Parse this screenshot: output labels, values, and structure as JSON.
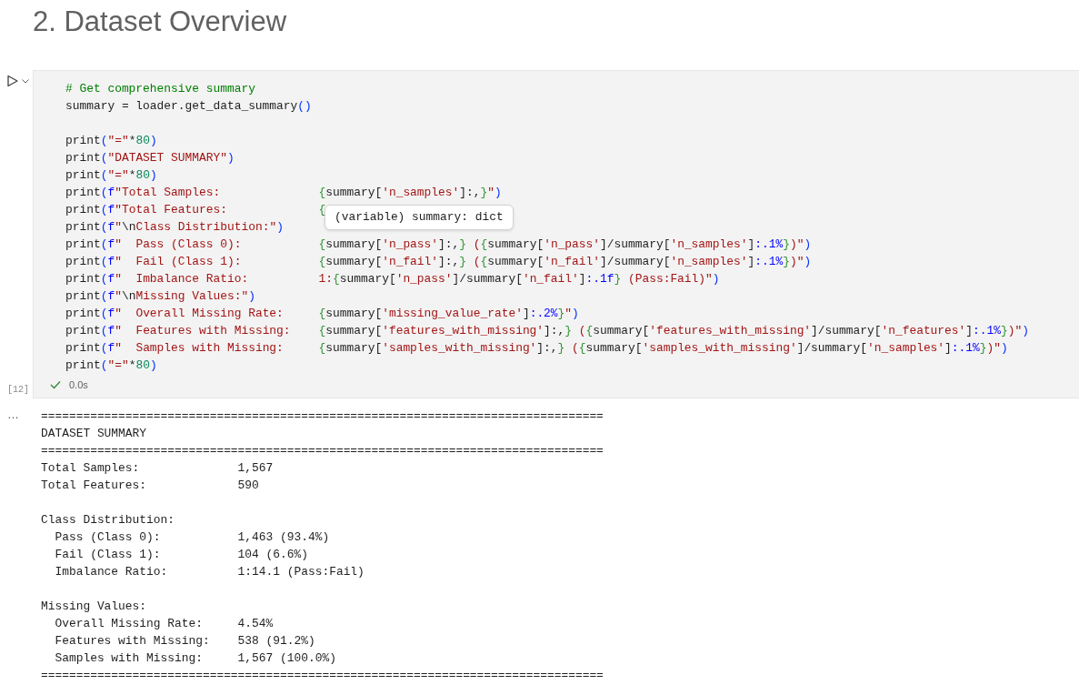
{
  "heading": "2. Dataset Overview",
  "cell": {
    "execution_count": "[12]",
    "succeeded": true,
    "duration": "0.0s",
    "tooltip": "(variable) summary: dict",
    "code_blocks": [
      [
        [
          {
            "kind": "comment",
            "text": "# Get comprehensive summary"
          }
        ],
        [
          {
            "kind": "plain",
            "text": "summary = loader.get_data_summary"
          },
          {
            "kind": "paren",
            "text": "()"
          }
        ]
      ],
      [
        [
          {
            "kind": "plain",
            "text": "print"
          },
          {
            "kind": "paren",
            "text": "("
          },
          {
            "kind": "string",
            "text": "\"=\""
          },
          {
            "kind": "plain",
            "text": "*"
          },
          {
            "kind": "number",
            "text": "80"
          },
          {
            "kind": "paren",
            "text": ")"
          }
        ],
        [
          {
            "kind": "plain",
            "text": "print"
          },
          {
            "kind": "paren",
            "text": "("
          },
          {
            "kind": "string",
            "text": "\"DATASET SUMMARY\""
          },
          {
            "kind": "paren",
            "text": ")"
          }
        ],
        [
          {
            "kind": "plain",
            "text": "print"
          },
          {
            "kind": "paren",
            "text": "("
          },
          {
            "kind": "string",
            "text": "\"=\""
          },
          {
            "kind": "plain",
            "text": "*"
          },
          {
            "kind": "number",
            "text": "80"
          },
          {
            "kind": "paren",
            "text": ")"
          }
        ],
        [
          {
            "kind": "plain",
            "text": "print"
          },
          {
            "kind": "paren",
            "text": "("
          },
          {
            "kind": "prefix",
            "text": "f"
          },
          {
            "kind": "string",
            "text": "\"Total Samples:              "
          },
          {
            "kind": "brace",
            "text": "{"
          },
          {
            "kind": "plain",
            "text": "summary["
          },
          {
            "kind": "string",
            "text": "'n_samples'"
          },
          {
            "kind": "plain",
            "text": "]:,"
          },
          {
            "kind": "brace",
            "text": "}"
          },
          {
            "kind": "string",
            "text": "\""
          },
          {
            "kind": "paren",
            "text": ")"
          }
        ],
        [
          {
            "kind": "plain",
            "text": "print"
          },
          {
            "kind": "paren",
            "text": "("
          },
          {
            "kind": "prefix",
            "text": "f"
          },
          {
            "kind": "string",
            "text": "\"Total Features:             "
          },
          {
            "kind": "brace",
            "text": "{"
          }
        ],
        [
          {
            "kind": "plain",
            "text": "print"
          },
          {
            "kind": "paren",
            "text": "("
          },
          {
            "kind": "prefix",
            "text": "f"
          },
          {
            "kind": "string",
            "text": "\""
          },
          {
            "kind": "plain",
            "text": "\\n"
          },
          {
            "kind": "string",
            "text": "Class Distribution:\""
          },
          {
            "kind": "paren",
            "text": ")"
          }
        ],
        [
          {
            "kind": "plain",
            "text": "print"
          },
          {
            "kind": "paren",
            "text": "("
          },
          {
            "kind": "prefix",
            "text": "f"
          },
          {
            "kind": "string",
            "text": "\"  Pass (Class 0):           "
          },
          {
            "kind": "brace",
            "text": "{"
          },
          {
            "kind": "plain",
            "text": "summary["
          },
          {
            "kind": "string",
            "text": "'n_pass'"
          },
          {
            "kind": "plain",
            "text": "]:,"
          },
          {
            "kind": "brace",
            "text": "}"
          },
          {
            "kind": "string",
            "text": " ("
          },
          {
            "kind": "brace",
            "text": "{"
          },
          {
            "kind": "plain",
            "text": "summary["
          },
          {
            "kind": "string",
            "text": "'n_pass'"
          },
          {
            "kind": "plain",
            "text": "]/summary["
          },
          {
            "kind": "string",
            "text": "'n_samples'"
          },
          {
            "kind": "plain",
            "text": "]"
          },
          {
            "kind": "spec",
            "text": ":.1%"
          },
          {
            "kind": "brace",
            "text": "}"
          },
          {
            "kind": "string",
            "text": ")\""
          },
          {
            "kind": "paren",
            "text": ")"
          }
        ],
        [
          {
            "kind": "plain",
            "text": "print"
          },
          {
            "kind": "paren",
            "text": "("
          },
          {
            "kind": "prefix",
            "text": "f"
          },
          {
            "kind": "string",
            "text": "\"  Fail (Class 1):           "
          },
          {
            "kind": "brace",
            "text": "{"
          },
          {
            "kind": "plain",
            "text": "summary["
          },
          {
            "kind": "string",
            "text": "'n_fail'"
          },
          {
            "kind": "plain",
            "text": "]:,"
          },
          {
            "kind": "brace",
            "text": "}"
          },
          {
            "kind": "string",
            "text": " ("
          },
          {
            "kind": "brace",
            "text": "{"
          },
          {
            "kind": "plain",
            "text": "summary["
          },
          {
            "kind": "string",
            "text": "'n_fail'"
          },
          {
            "kind": "plain",
            "text": "]/summary["
          },
          {
            "kind": "string",
            "text": "'n_samples'"
          },
          {
            "kind": "plain",
            "text": "]"
          },
          {
            "kind": "spec",
            "text": ":.1%"
          },
          {
            "kind": "brace",
            "text": "}"
          },
          {
            "kind": "string",
            "text": ")\""
          },
          {
            "kind": "paren",
            "text": ")"
          }
        ],
        [
          {
            "kind": "plain",
            "text": "print"
          },
          {
            "kind": "paren",
            "text": "("
          },
          {
            "kind": "prefix",
            "text": "f"
          },
          {
            "kind": "string",
            "text": "\"  Imbalance Ratio:          1:"
          },
          {
            "kind": "brace",
            "text": "{"
          },
          {
            "kind": "plain",
            "text": "summary["
          },
          {
            "kind": "string",
            "text": "'n_pass'"
          },
          {
            "kind": "plain",
            "text": "]/summary["
          },
          {
            "kind": "string",
            "text": "'n_fail'"
          },
          {
            "kind": "plain",
            "text": "]"
          },
          {
            "kind": "spec",
            "text": ":.1f"
          },
          {
            "kind": "brace",
            "text": "}"
          },
          {
            "kind": "string",
            "text": " (Pass:Fail)\""
          },
          {
            "kind": "paren",
            "text": ")"
          }
        ],
        [
          {
            "kind": "plain",
            "text": "print"
          },
          {
            "kind": "paren",
            "text": "("
          },
          {
            "kind": "prefix",
            "text": "f"
          },
          {
            "kind": "string",
            "text": "\""
          },
          {
            "kind": "plain",
            "text": "\\n"
          },
          {
            "kind": "string",
            "text": "Missing Values:\""
          },
          {
            "kind": "paren",
            "text": ")"
          }
        ],
        [
          {
            "kind": "plain",
            "text": "print"
          },
          {
            "kind": "paren",
            "text": "("
          },
          {
            "kind": "prefix",
            "text": "f"
          },
          {
            "kind": "string",
            "text": "\"  Overall Missing Rate:     "
          },
          {
            "kind": "brace",
            "text": "{"
          },
          {
            "kind": "plain",
            "text": "summary["
          },
          {
            "kind": "string",
            "text": "'missing_value_rate'"
          },
          {
            "kind": "plain",
            "text": "]"
          },
          {
            "kind": "spec",
            "text": ":.2%"
          },
          {
            "kind": "brace",
            "text": "}"
          },
          {
            "kind": "string",
            "text": "\""
          },
          {
            "kind": "paren",
            "text": ")"
          }
        ],
        [
          {
            "kind": "plain",
            "text": "print"
          },
          {
            "kind": "paren",
            "text": "("
          },
          {
            "kind": "prefix",
            "text": "f"
          },
          {
            "kind": "string",
            "text": "\"  Features with Missing:    "
          },
          {
            "kind": "brace",
            "text": "{"
          },
          {
            "kind": "plain",
            "text": "summary["
          },
          {
            "kind": "string",
            "text": "'features_with_missing'"
          },
          {
            "kind": "plain",
            "text": "]:,"
          },
          {
            "kind": "brace",
            "text": "}"
          },
          {
            "kind": "string",
            "text": " ("
          },
          {
            "kind": "brace",
            "text": "{"
          },
          {
            "kind": "plain",
            "text": "summary["
          },
          {
            "kind": "string",
            "text": "'features_with_missing'"
          },
          {
            "kind": "plain",
            "text": "]/summary["
          },
          {
            "kind": "string",
            "text": "'n_features'"
          },
          {
            "kind": "plain",
            "text": "]"
          },
          {
            "kind": "spec",
            "text": ":.1%"
          },
          {
            "kind": "brace",
            "text": "}"
          },
          {
            "kind": "string",
            "text": ")\""
          },
          {
            "kind": "paren",
            "text": ")"
          }
        ],
        [
          {
            "kind": "plain",
            "text": "print"
          },
          {
            "kind": "paren",
            "text": "("
          },
          {
            "kind": "prefix",
            "text": "f"
          },
          {
            "kind": "string",
            "text": "\"  Samples with Missing:     "
          },
          {
            "kind": "brace",
            "text": "{"
          },
          {
            "kind": "plain",
            "text": "summary["
          },
          {
            "kind": "string",
            "text": "'samples_with_missing'"
          },
          {
            "kind": "plain",
            "text": "]:,"
          },
          {
            "kind": "brace",
            "text": "}"
          },
          {
            "kind": "string",
            "text": " ("
          },
          {
            "kind": "brace",
            "text": "{"
          },
          {
            "kind": "plain",
            "text": "summary["
          },
          {
            "kind": "string",
            "text": "'samples_with_missing'"
          },
          {
            "kind": "plain",
            "text": "]/summary["
          },
          {
            "kind": "string",
            "text": "'n_samples'"
          },
          {
            "kind": "plain",
            "text": "]"
          },
          {
            "kind": "spec",
            "text": ":.1%"
          },
          {
            "kind": "brace",
            "text": "}"
          },
          {
            "kind": "string",
            "text": ")\""
          },
          {
            "kind": "paren",
            "text": ")"
          }
        ],
        [
          {
            "kind": "plain",
            "text": "print"
          },
          {
            "kind": "paren",
            "text": "("
          },
          {
            "kind": "string",
            "text": "\"=\""
          },
          {
            "kind": "plain",
            "text": "*"
          },
          {
            "kind": "number",
            "text": "80"
          },
          {
            "kind": "paren",
            "text": ")"
          }
        ]
      ]
    ]
  },
  "output": {
    "menu": "…",
    "blocks": [
      [
        "================================================================================",
        "DATASET SUMMARY",
        "================================================================================",
        "Total Samples:              1,567",
        "Total Features:             590"
      ],
      [
        "Class Distribution:",
        "  Pass (Class 0):           1,463 (93.4%)",
        "  Fail (Class 1):           104 (6.6%)",
        "  Imbalance Ratio:          1:14.1 (Pass:Fail)"
      ],
      [
        "Missing Values:",
        "  Overall Missing Rate:     4.54%",
        "  Features with Missing:    538 (91.2%)",
        "  Samples with Missing:     1,567 (100.0%)",
        "================================================================================"
      ]
    ]
  }
}
